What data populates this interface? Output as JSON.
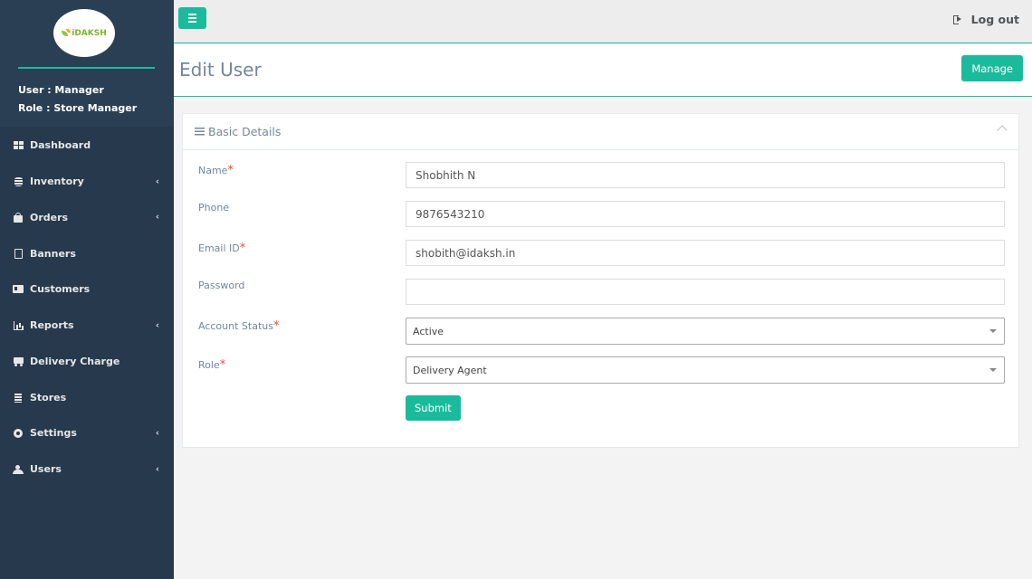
{
  "brand": {
    "logo_text": "iDAKSH"
  },
  "user": {
    "user_line": "User : Manager",
    "role_line": "Role : Store Manager"
  },
  "nav": [
    {
      "label": "Dashboard",
      "icon": "dashboard-icon",
      "has_submenu": false
    },
    {
      "label": "Inventory",
      "icon": "database-icon",
      "has_submenu": true
    },
    {
      "label": "Orders",
      "icon": "shopping-bag-icon",
      "has_submenu": true
    },
    {
      "label": "Banners",
      "icon": "file-image-icon",
      "has_submenu": false
    },
    {
      "label": "Customers",
      "icon": "id-card-icon",
      "has_submenu": false
    },
    {
      "label": "Reports",
      "icon": "bar-chart-icon",
      "has_submenu": true
    },
    {
      "label": "Delivery Charge",
      "icon": "truck-icon",
      "has_submenu": false
    },
    {
      "label": "Stores",
      "icon": "building-icon",
      "has_submenu": false
    },
    {
      "label": "Settings",
      "icon": "gear-icon",
      "has_submenu": true
    },
    {
      "label": "Users",
      "icon": "users-icon",
      "has_submenu": true
    }
  ],
  "topbar": {
    "logout_label": "Log out"
  },
  "page": {
    "title": "Edit User",
    "manage_label": "Manage"
  },
  "panel": {
    "title": "Basic Details"
  },
  "form": {
    "name": {
      "label": "Name",
      "required": true,
      "value": "Shobhith N"
    },
    "phone": {
      "label": "Phone",
      "required": false,
      "value": "9876543210"
    },
    "email": {
      "label": "Email ID",
      "required": true,
      "value": "shobith@idaksh.in"
    },
    "password": {
      "label": "Password",
      "required": false,
      "value": ""
    },
    "account_status": {
      "label": "Account Status",
      "required": true,
      "value": "Active"
    },
    "role": {
      "label": "Role",
      "required": true,
      "value": "Delivery Agent"
    },
    "submit_label": "Submit",
    "required_mark": "*"
  },
  "colors": {
    "accent": "#1abb9c",
    "sidebar": "#2a3f54",
    "required": "#e74c3c"
  }
}
